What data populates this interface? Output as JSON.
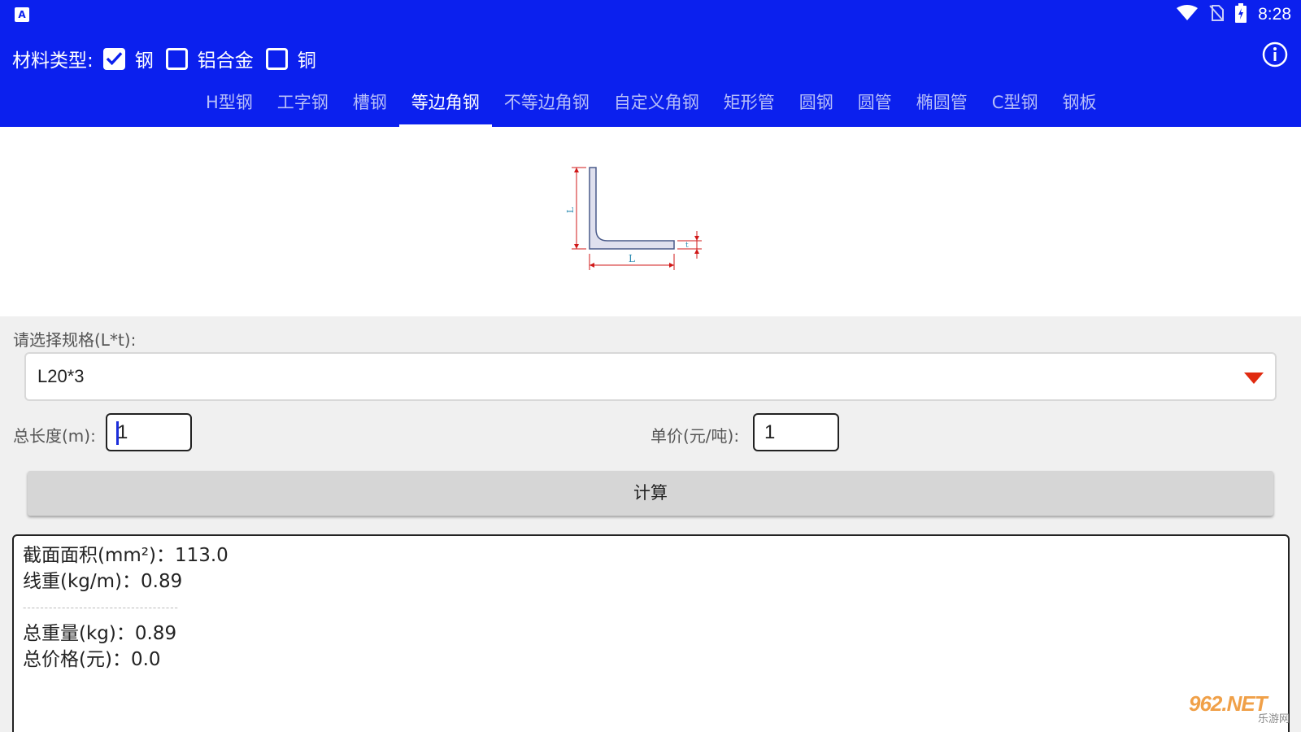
{
  "status_bar": {
    "time": "8:28",
    "app_icon_letter": "A"
  },
  "material": {
    "label": "材料类型:",
    "options": [
      {
        "label": "钢",
        "checked": true
      },
      {
        "label": "铝合金",
        "checked": false
      },
      {
        "label": "铜",
        "checked": false
      }
    ]
  },
  "tabs": [
    "H型钢",
    "工字钢",
    "槽钢",
    "等边角钢",
    "不等边角钢",
    "自定义角钢",
    "矩形管",
    "圆钢",
    "圆管",
    "椭圆管",
    "C型钢",
    "钢板"
  ],
  "active_tab": "等边角钢",
  "figure": {
    "dim_L_vertical": "L",
    "dim_L_horizontal": "L",
    "dim_t": "t"
  },
  "spec": {
    "label": "请选择规格(L*t):",
    "selected": "L20*3"
  },
  "length": {
    "label": "总长度(m):",
    "value": "1"
  },
  "price": {
    "label": "单价(元/吨):",
    "value": "1"
  },
  "calc_button": "计算",
  "results": {
    "area": "截面面积(mm²)：113.0",
    "line_weight": "线重(kg/m)：0.89",
    "divider": "------------------------------------",
    "total_weight": "总重量(kg)：0.89",
    "total_price": "总价格(元)：0.0"
  },
  "watermark": {
    "top": "962.NET",
    "bottom": "乐游网"
  },
  "colors": {
    "header_blue": "#0b20ee",
    "arrow_red": "#e02a10"
  }
}
